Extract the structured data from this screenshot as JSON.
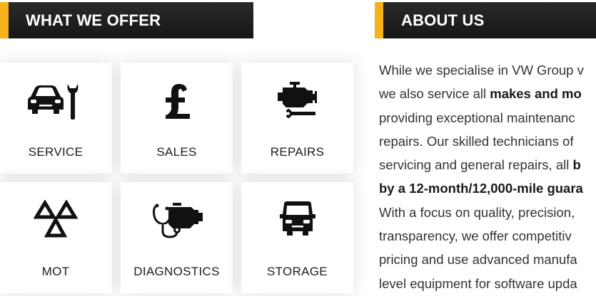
{
  "offer": {
    "title": "WHAT WE OFFER",
    "tiles": [
      {
        "label": "SERVICE",
        "icon": "car-wrench-icon"
      },
      {
        "label": "SALES",
        "icon": "pound-sign-icon"
      },
      {
        "label": "REPAIRS",
        "icon": "engine-wrench-icon"
      },
      {
        "label": "MOT",
        "icon": "mot-triangles-icon"
      },
      {
        "label": "DIAGNOSTICS",
        "icon": "engine-stethoscope-icon"
      },
      {
        "label": "STORAGE",
        "icon": "van-icon"
      }
    ]
  },
  "about": {
    "title": "ABOUT US",
    "lines": [
      {
        "pre": "While we specialise in VW Group v",
        "bold": "",
        "post": ""
      },
      {
        "pre": "we also service all ",
        "bold": "makes and mo",
        "post": ""
      },
      {
        "pre": "providing exceptional maintenanc",
        "bold": "",
        "post": ""
      },
      {
        "pre": "repairs. Our skilled technicians of",
        "bold": "",
        "post": ""
      },
      {
        "pre": "servicing and general repairs, all ",
        "bold": "b",
        "post": ""
      },
      {
        "pre": "",
        "bold": "by a 12-month/12,000-mile guara",
        "post": ""
      },
      {
        "pre": "With a focus on quality, precision,",
        "bold": "",
        "post": ""
      },
      {
        "pre": "transparency, we offer competitiv",
        "bold": "",
        "post": ""
      },
      {
        "pre": "pricing and use advanced manufa",
        "bold": "",
        "post": ""
      },
      {
        "pre": "level equipment for software upda",
        "bold": "",
        "post": ""
      }
    ]
  },
  "colors": {
    "accent": "#f5b21c",
    "header_bg": "#1f1f1f",
    "header_text": "#ffffff",
    "icon": "#111111"
  }
}
